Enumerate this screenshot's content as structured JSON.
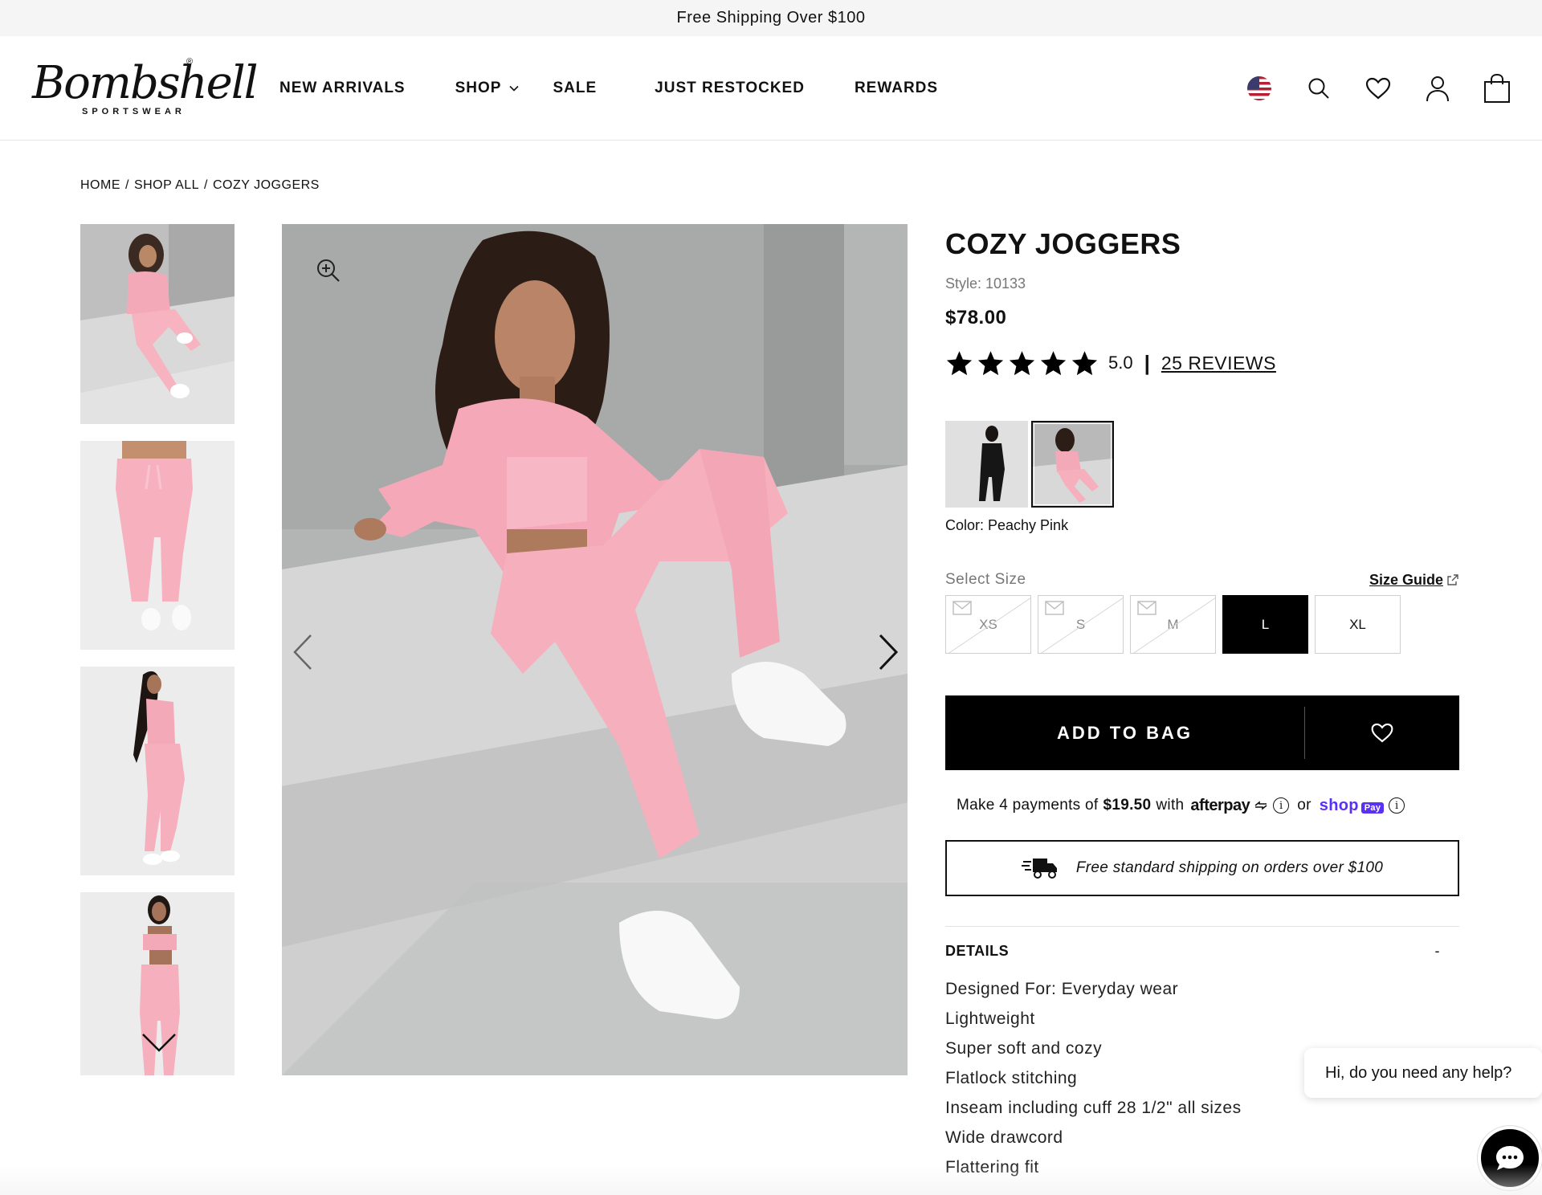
{
  "announcement": "Free Shipping Over $100",
  "logo": {
    "script": "Bombshell",
    "sub": "SPORTSWEAR",
    "reg": "®"
  },
  "nav": {
    "items": [
      "NEW ARRIVALS",
      "SHOP",
      "SALE",
      "JUST RESTOCKED",
      "REWARDS"
    ]
  },
  "header_icons": [
    "us-flag-icon",
    "search-icon",
    "heart-icon",
    "account-icon",
    "bag-icon"
  ],
  "breadcrumb": [
    "HOME",
    "/",
    "SHOP ALL",
    "/",
    "COZY JOGGERS"
  ],
  "product": {
    "title": "COZY JOGGERS",
    "style": "Style: 10133",
    "price": "$78.00",
    "rating_value": 5.0,
    "rating": "5.0",
    "rating_sep": "|",
    "reviews": "25 REVIEWS",
    "color_label": "Color: Peachy Pink",
    "swatches": [
      {
        "name": "black",
        "selected": false
      },
      {
        "name": "peachy pink",
        "selected": true
      }
    ],
    "size_label": "Select Size",
    "size_guide": "Size Guide",
    "sizes": [
      {
        "label": "XS",
        "available": false,
        "selected": false
      },
      {
        "label": "S",
        "available": false,
        "selected": false
      },
      {
        "label": "M",
        "available": false,
        "selected": false
      },
      {
        "label": "L",
        "available": true,
        "selected": true
      },
      {
        "label": "XL",
        "available": true,
        "selected": false
      }
    ],
    "add_to_bag": "ADD TO BAG",
    "payments": {
      "prefix": "Make 4 payments of",
      "amount": "$19.50",
      "with": "with",
      "afterpay": "afterpay",
      "or": "or",
      "shop": "shop",
      "pay": "Pay"
    },
    "shipping_note": "Free standard shipping on orders over $100",
    "details": {
      "heading": "DETAILS",
      "toggle": "-",
      "items": [
        "Designed For: Everyday wear",
        "Lightweight",
        "Super soft and cozy",
        "Flatlock stitching",
        "Inseam including cuff 28 1/2\" all sizes",
        "Wide drawcord",
        "Flattering fit"
      ]
    }
  },
  "chat": {
    "bubble": "Hi, do you need any help?"
  },
  "colors": {
    "accent": "#000000",
    "shop_pay": "#5a31f4",
    "pink": "#f4a9b8"
  }
}
